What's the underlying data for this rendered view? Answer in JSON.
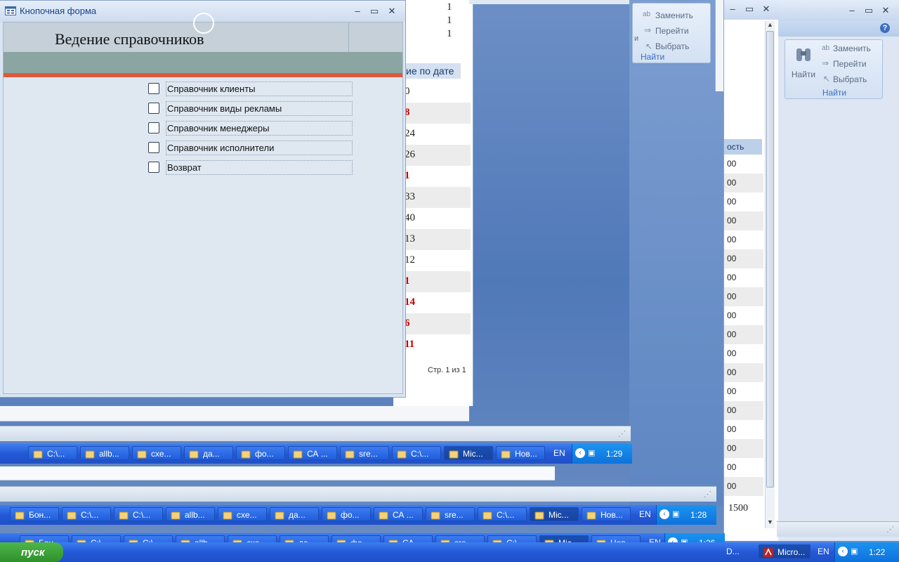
{
  "form_window": {
    "title": "Кнопочная форма",
    "heading": "Ведение справочников",
    "items": [
      {
        "label": "Справочник клиенты"
      },
      {
        "label": "Справочник виды рекламы"
      },
      {
        "label": "Справочник менеджеры"
      },
      {
        "label": "Справочник исполнители"
      },
      {
        "label": "Возврат"
      }
    ]
  },
  "report_window": {
    "top_values": [
      "1",
      "1",
      "1"
    ],
    "column_header": "ие по дате",
    "values": [
      {
        "text": "0",
        "red": false
      },
      {
        "text": "8",
        "red": true
      },
      {
        "text": "24",
        "red": false
      },
      {
        "text": "26",
        "red": false
      },
      {
        "text": "1",
        "red": true
      },
      {
        "text": "33",
        "red": false
      },
      {
        "text": "40",
        "red": false
      },
      {
        "text": "13",
        "red": false
      },
      {
        "text": "12",
        "red": false
      },
      {
        "text": "1",
        "red": true
      },
      {
        "text": "14",
        "red": true
      },
      {
        "text": "6",
        "red": true
      },
      {
        "text": "11",
        "red": true
      }
    ],
    "page_label": "Стр. 1 из 1"
  },
  "ribbon_mid": {
    "replace": "Заменить",
    "goto": "Перейти",
    "select": "Выбрать",
    "group": "Найти",
    "left_fragment": "и"
  },
  "ribbon_right": {
    "find": "Найти",
    "replace": "Заменить",
    "goto": "Перейти",
    "select": "Выбрать",
    "group": "Найти",
    "column_header": "ость",
    "values": [
      "00",
      "00",
      "00",
      "00",
      "00",
      "00",
      "00",
      "00",
      "00",
      "00",
      "00",
      "00",
      "00",
      "00",
      "00",
      "00",
      "00",
      "00"
    ],
    "total": "1500"
  },
  "taskbar1": {
    "buttons": [
      "C:\\...",
      "allb...",
      "схе...",
      "да...",
      "фо...",
      "СА ...",
      "sre...",
      "C:\\...",
      "Mic...",
      "Нов..."
    ],
    "lang": "EN",
    "time": "1:29"
  },
  "taskbar2": {
    "buttons": [
      "Бон...",
      "C:\\...",
      "C:\\...",
      "allb...",
      "схе...",
      "да...",
      "фо...",
      "СА ...",
      "sre...",
      "C:\\...",
      "Mic...",
      "Нов..."
    ],
    "lang": "EN",
    "time": "1:28"
  },
  "taskbar3": {
    "buttons": [
      "Бон...",
      "C:\\...",
      "C:\\...",
      "allb...",
      "схе...",
      "да...",
      "фо...",
      "СА ...",
      "sre...",
      "C:\\...",
      "Mic...",
      "Нов..."
    ],
    "lang": "EN",
    "time": "1:26"
  },
  "taskbar4": {
    "start": "пуск",
    "fragment": "D...",
    "app": "Micro...",
    "lang": "EN",
    "time": "1:22"
  },
  "colors": {
    "title_bar": "#dbe7f7",
    "form_bg": "#dfe8f1",
    "accent_red": "#dc5a3c",
    "teal_band": "#8ba5a3",
    "taskbar": "#2458d6"
  }
}
